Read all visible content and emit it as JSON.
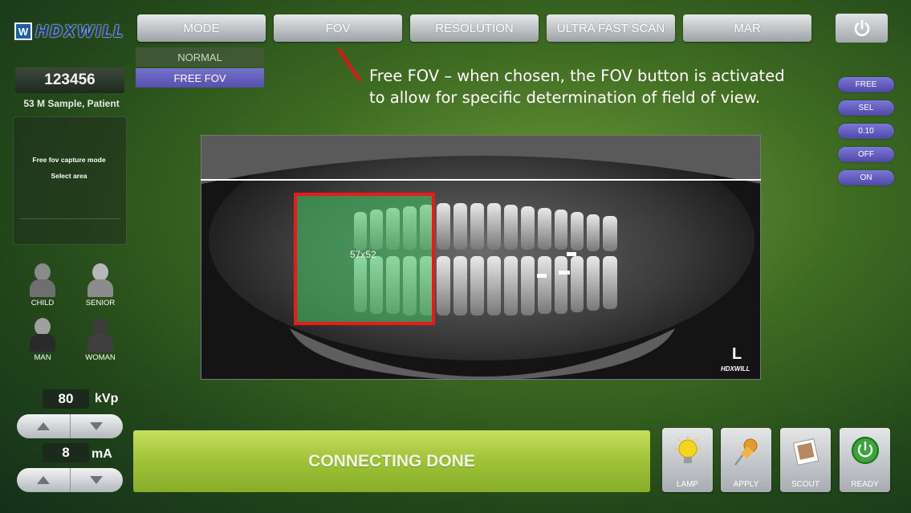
{
  "logo": {
    "badge": "W",
    "text": "HDXWILL"
  },
  "toolbar": {
    "mode": "MODE",
    "fov": "FOV",
    "resolution": "RESOLUTION",
    "ultra_fast_scan": "ULTRA FAST SCAN",
    "mar": "MAR",
    "power_icon": "power-icon"
  },
  "mode_menu": {
    "options": [
      "NORMAL",
      "FREE FOV"
    ],
    "selected": "FREE FOV"
  },
  "annotation": {
    "line1": "Free FOV – when chosen, the FOV button is activated",
    "line2": "to allow for specific determination of field of view."
  },
  "patient": {
    "id": "123456",
    "info": "53 M Sample, Patient"
  },
  "info_panel": {
    "line1": "Free fov capture mode",
    "line2": "Select area"
  },
  "patient_types": [
    "CHILD",
    "SENIOR",
    "MAN",
    "WOMAN"
  ],
  "kvp": {
    "value": "80",
    "unit": "kVp"
  },
  "ma": {
    "value": "8",
    "unit": "mA"
  },
  "xray": {
    "fov_label": "57x52",
    "side_marker": "L",
    "brand": "HDXWILL"
  },
  "right_options": [
    "FREE",
    "SEL",
    "0.10",
    "OFF",
    "ON"
  ],
  "status": {
    "text": "CONNECTING DONE"
  },
  "actions": [
    "LAMP",
    "APPLY",
    "SCOUT",
    "READY"
  ],
  "colors": {
    "accent_purple": "#5650b0",
    "fov_border": "#e81a1a",
    "status_green": "#9fc238",
    "ready_green": "#3aa63a"
  }
}
